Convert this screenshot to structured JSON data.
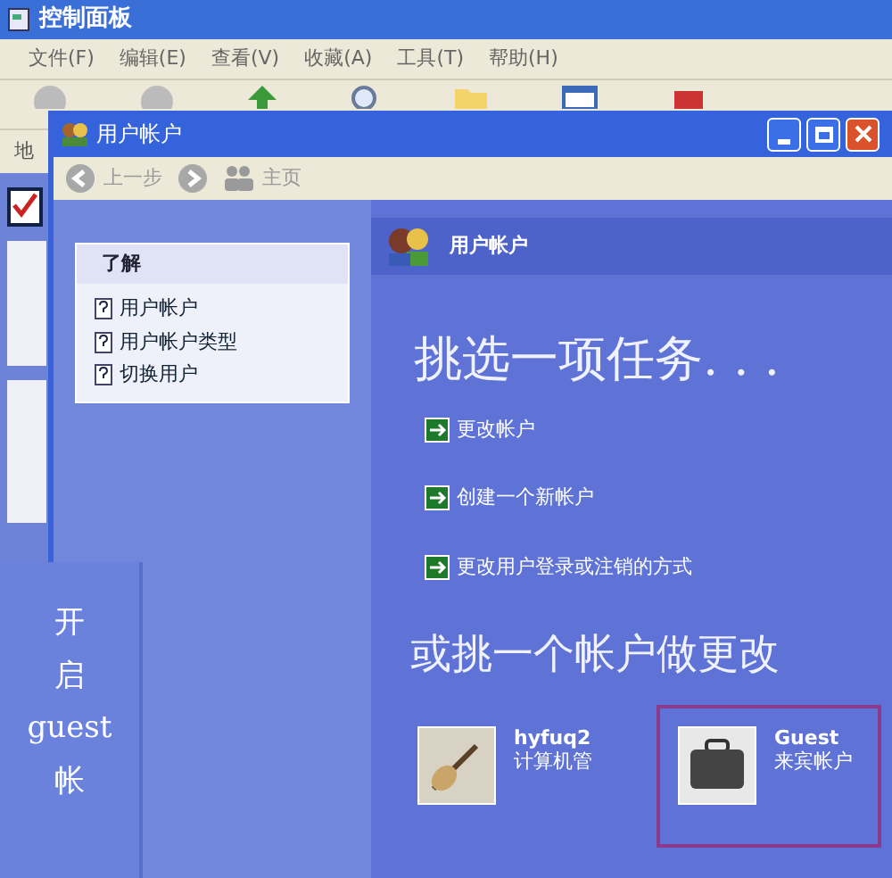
{
  "back_window": {
    "title": "控制面板",
    "menu": [
      "文件(F)",
      "编辑(E)",
      "查看(V)",
      "收藏(A)",
      "工具(T)",
      "帮助(H)"
    ],
    "address_label": "地"
  },
  "window": {
    "title": "用户帐户",
    "nav": [
      {
        "kind": "back",
        "label": "上一步"
      },
      {
        "kind": "forward"
      },
      {
        "kind": "home",
        "label": "主页"
      }
    ]
  },
  "sidebar": {
    "title": "了解",
    "items": [
      "用户帐户",
      "用户帐户类型",
      "切换用户"
    ]
  },
  "header": "用户帐户",
  "task_heading": "挑选一项任务. . .",
  "tasks": [
    "更改帐户",
    "创建一个新帐户",
    "更改用户登录或注销的方式"
  ],
  "account_heading": "或挑一个帐户做更改",
  "accounts": [
    {
      "kind": "guitar",
      "name": "hyfuq2",
      "type": "计算机管",
      "selected": false
    },
    {
      "kind": "briefcase",
      "name": "Guest",
      "type": "来宾帐户",
      "selected": true
    }
  ],
  "annotation": [
    "开",
    "启",
    "guest",
    "帐"
  ]
}
